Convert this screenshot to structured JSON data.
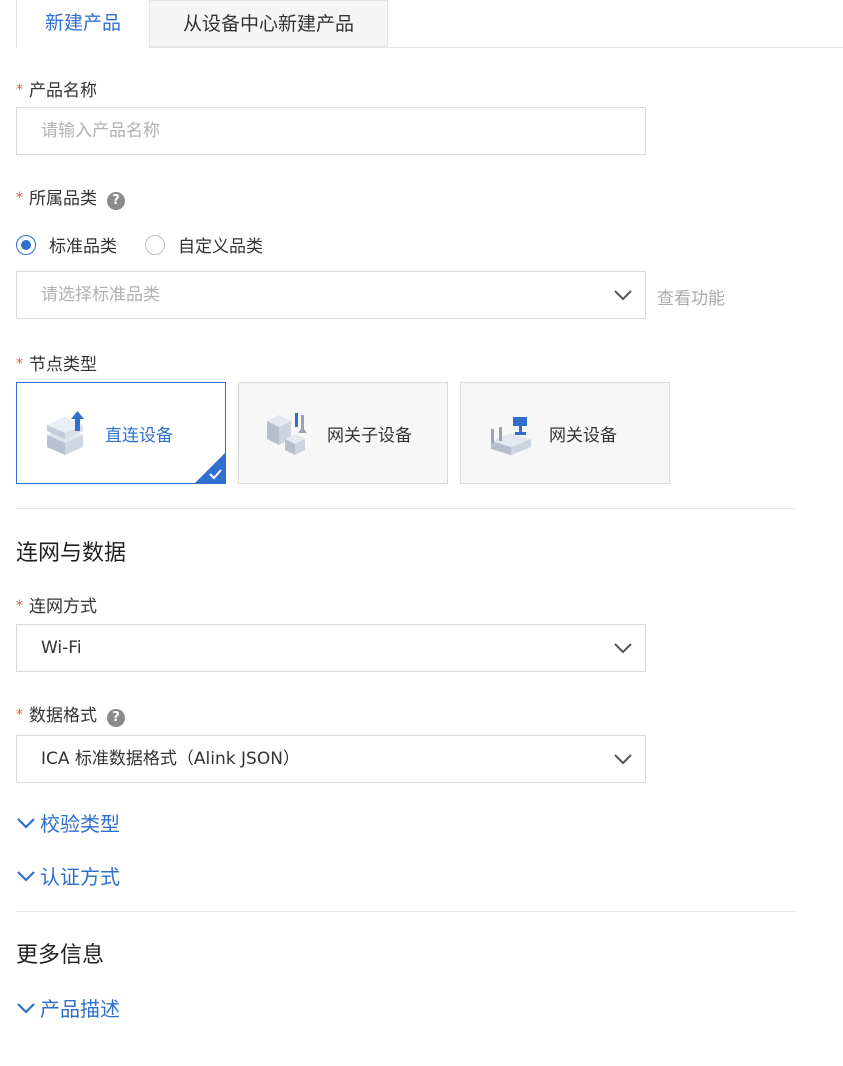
{
  "tabs": {
    "active": "新建产品",
    "other": "从设备中心新建产品"
  },
  "form": {
    "required_mark": "*",
    "product_name": {
      "label": "产品名称",
      "placeholder": "请输入产品名称"
    },
    "category": {
      "label": "所属品类",
      "help": "?",
      "options": [
        "标准品类",
        "自定义品类"
      ],
      "selected": "标准品类",
      "select_placeholder": "请选择标准品类",
      "view_link": "查看功能"
    },
    "node_type": {
      "label": "节点类型",
      "options": [
        "直连设备",
        "网关子设备",
        "网关设备"
      ],
      "selected": "直连设备"
    }
  },
  "network_section": {
    "title": "连网与数据",
    "connection": {
      "label": "连网方式",
      "value": "Wi-Fi"
    },
    "data_format": {
      "label": "数据格式",
      "help": "?",
      "value": "ICA 标准数据格式（Alink JSON）"
    },
    "collapsibles": [
      "校验类型",
      "认证方式"
    ]
  },
  "more_section": {
    "title": "更多信息",
    "collapsibles": [
      "产品描述"
    ]
  },
  "colors": {
    "primary": "#2f6fd0",
    "required": "#e0583c",
    "border": "#d9d9d9"
  }
}
